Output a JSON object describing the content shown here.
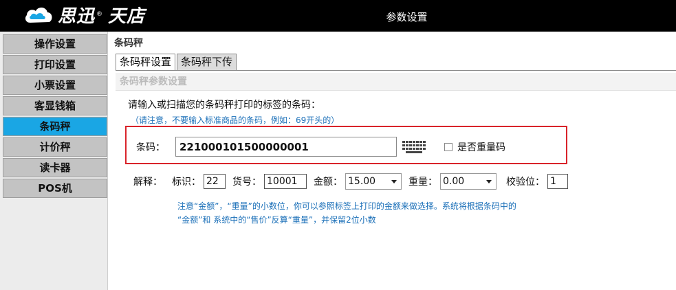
{
  "app": {
    "brand": "思迅",
    "brand_reg": "®",
    "brand_product": "天店",
    "window_title": "参数设置"
  },
  "sidebar": {
    "items": [
      {
        "label": "操作设置",
        "active": false
      },
      {
        "label": "打印设置",
        "active": false
      },
      {
        "label": "小票设置",
        "active": false
      },
      {
        "label": "客显钱箱",
        "active": false
      },
      {
        "label": "条码秤",
        "active": true
      },
      {
        "label": "计价秤",
        "active": false
      },
      {
        "label": "读卡器",
        "active": false
      },
      {
        "label": "POS机",
        "active": false
      }
    ]
  },
  "main": {
    "page_title": "条码秤",
    "tabs": [
      {
        "label": "条码秤设置",
        "active": true
      },
      {
        "label": "条码秤下传",
        "active": false
      }
    ],
    "section_header": "条码秤参数设置",
    "prompt": "请输入或扫描您的条码秤打印的标签的条码：",
    "note": "（请注意，不要输入标准商品的条码，例如：69开头的）",
    "barcode": {
      "label": "条码：",
      "value": "221000101500000001"
    },
    "weight_code": {
      "label": "是否重量码",
      "checked": false
    },
    "explain": {
      "label": "解释：",
      "id_label": "标识：",
      "id_value": "22",
      "item_label": "货号：",
      "item_value": "10001",
      "amount_label": "金额：",
      "amount_value": "15.00",
      "weight_label": "重量：",
      "weight_value": "0.00",
      "check_label": "校验位：",
      "check_value": "1"
    },
    "hint_line1": "注意“金额”，“重量”的小数位，你可以参照标签上打印的金额来做选择。系统将根据条码中的",
    "hint_line2": "“金额”和 系统中的“售价”反算“重量”，并保留2位小数"
  },
  "colors": {
    "active_sidebar": "#1aa6e4",
    "highlight_box": "#d9232a",
    "note_text": "#1a6fb8"
  }
}
